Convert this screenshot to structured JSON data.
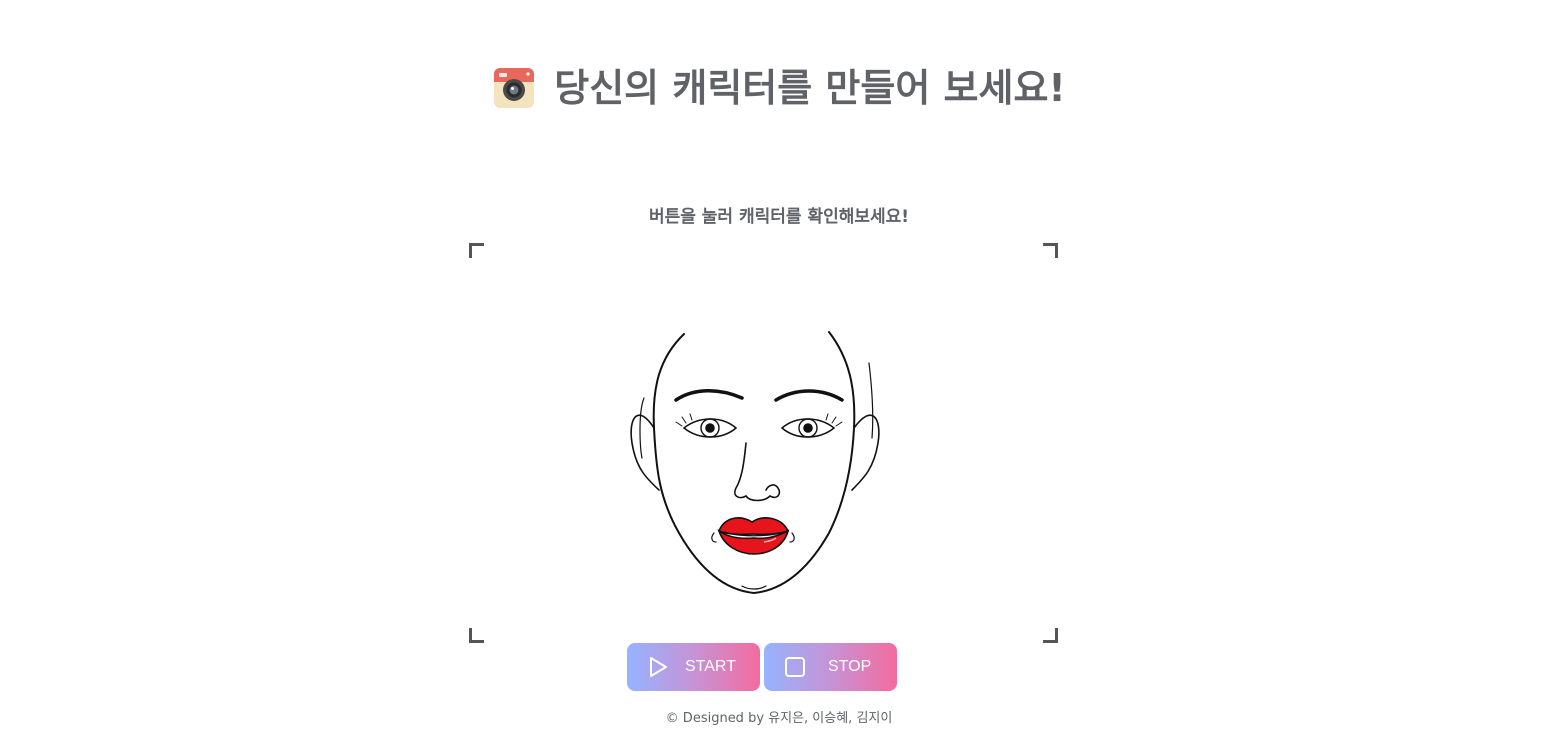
{
  "header": {
    "title": "당신의 캐릭터를 만들어 보세요!",
    "icon": "camera-icon"
  },
  "main": {
    "subtitle": "버튼을 눌러 캐릭터를 확인해보세요!",
    "preview_image": "face-sketch-with-red-lips"
  },
  "controls": {
    "start_label": "START",
    "stop_label": "STOP",
    "start_icon": "play-icon",
    "stop_icon": "stop-icon"
  },
  "footer": {
    "credits": "© Designed by 유지은, 이승혜, 김지이"
  },
  "colors": {
    "text": "#5f6368",
    "button_gradient_start": "#96b3ff",
    "button_gradient_end": "#f46b9f",
    "lips": "#e8141c",
    "frame_corners": "#555555"
  }
}
